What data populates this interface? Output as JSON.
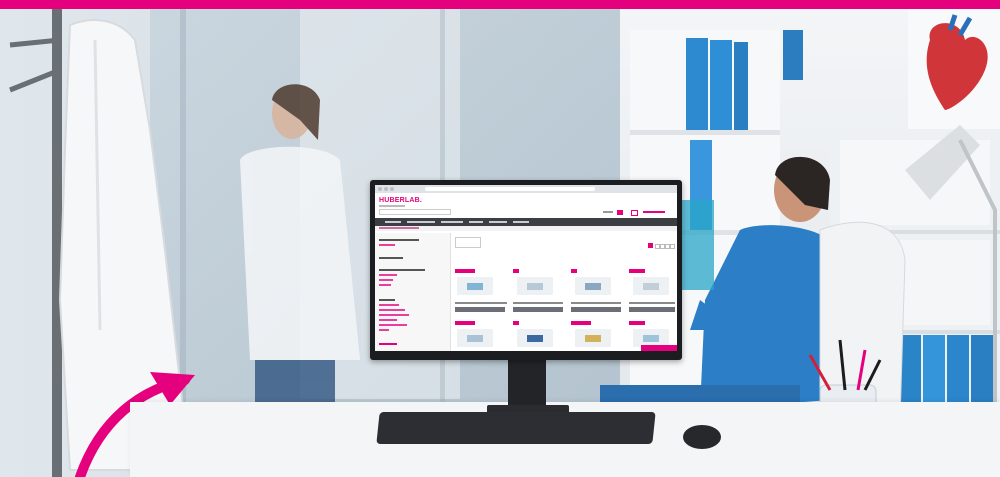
{
  "scene": {
    "accent_color": "#e5007e",
    "description_icons": [
      "lab-coat",
      "doctor",
      "nurse",
      "monitor",
      "keyboard",
      "mouse",
      "desk-lamp",
      "pen-cup",
      "binders",
      "heart-poster"
    ]
  },
  "website": {
    "logo_text": "HUBERLAB."
  }
}
